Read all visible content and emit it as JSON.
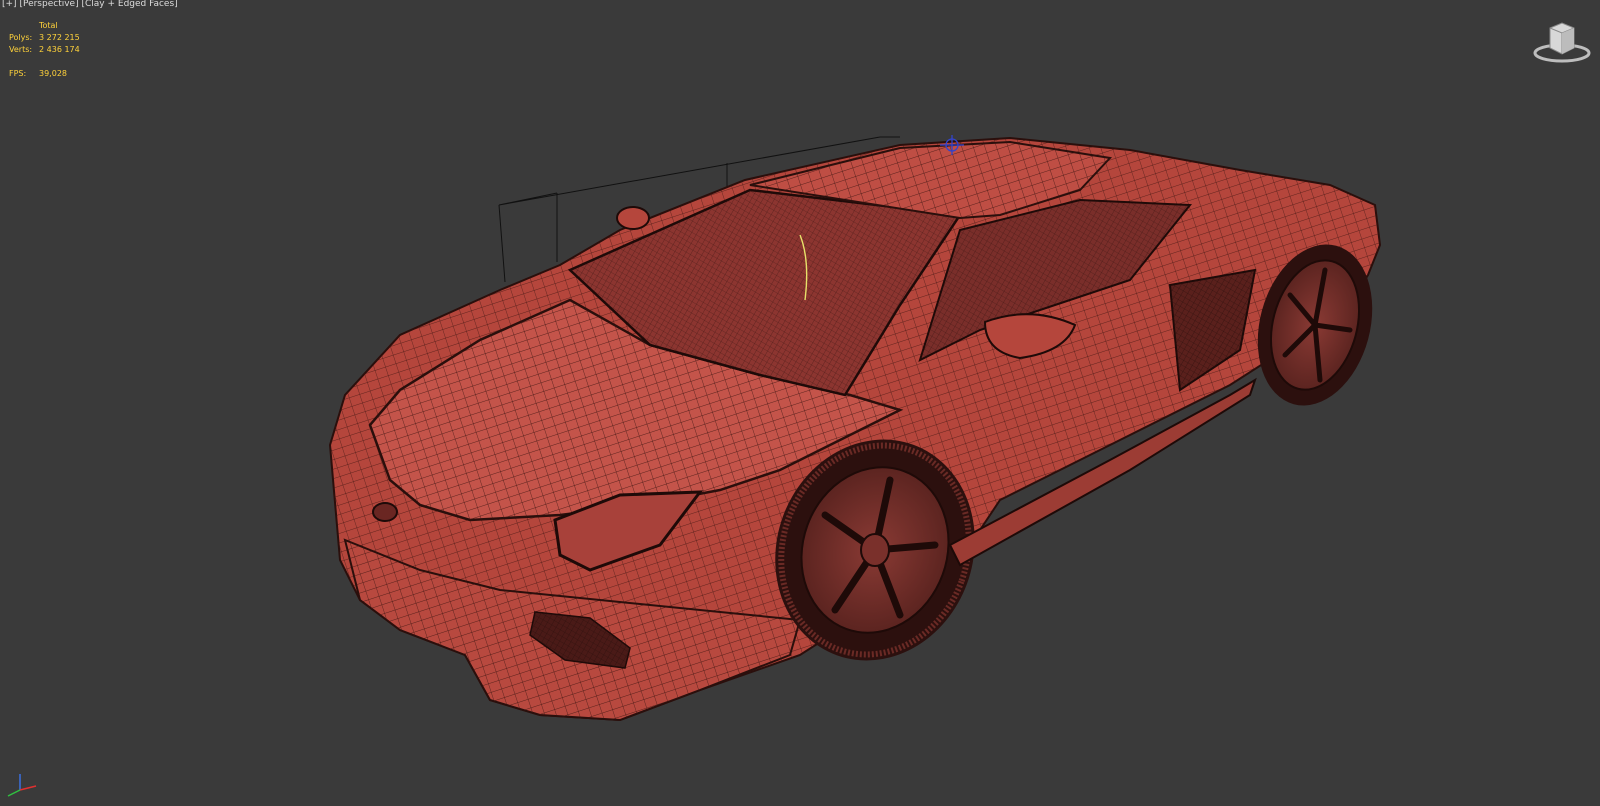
{
  "viewport": {
    "menu_plus": "[+]",
    "view_name": "[Perspective]",
    "shading_mode": "[Clay + Edged Faces]",
    "background_color": "#3a3a3a"
  },
  "stats": {
    "header": "Total",
    "polys_label": "Polys:",
    "polys_value": "3 272 215",
    "verts_label": "Verts:",
    "verts_value": "2 436 174",
    "fps_label": "FPS:",
    "fps_value": "39,028",
    "text_color": "#ffd23a"
  },
  "model": {
    "clay_color": "#b5463c",
    "wire_color": "#2a0f0c"
  },
  "icons": {
    "viewcube": "viewcube-icon",
    "axis": "axis-tripod-icon"
  }
}
